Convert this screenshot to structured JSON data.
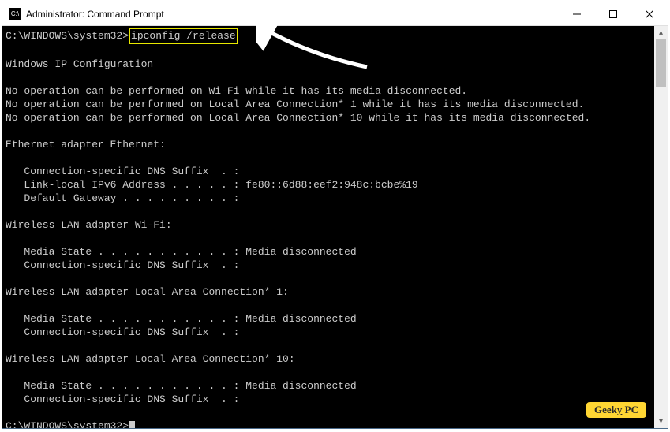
{
  "window": {
    "title": "Administrator: Command Prompt",
    "icon_label": "C:\\"
  },
  "terminal": {
    "prompt1_path": "C:\\WINDOWS\\system32>",
    "command_highlighted": "ipconfig /release",
    "blank1": "",
    "heading": "Windows IP Configuration",
    "blank2": "",
    "noop1": "No operation can be performed on Wi-Fi while it has its media disconnected.",
    "noop2": "No operation can be performed on Local Area Connection* 1 while it has its media disconnected.",
    "noop3": "No operation can be performed on Local Area Connection* 10 while it has its media disconnected.",
    "blank3": "",
    "adapter_eth_title": "Ethernet adapter Ethernet:",
    "blank4": "",
    "eth_suffix": "   Connection-specific DNS Suffix  . :",
    "eth_ipv6": "   Link-local IPv6 Address . . . . . : fe80::6d88:eef2:948c:bcbe%19",
    "eth_gw": "   Default Gateway . . . . . . . . . :",
    "blank5": "",
    "adapter_wifi_title": "Wireless LAN adapter Wi-Fi:",
    "blank6": "",
    "wifi_media": "   Media State . . . . . . . . . . . : Media disconnected",
    "wifi_suffix": "   Connection-specific DNS Suffix  . :",
    "blank7": "",
    "adapter_lac1_title": "Wireless LAN adapter Local Area Connection* 1:",
    "blank8": "",
    "lac1_media": "   Media State . . . . . . . . . . . : Media disconnected",
    "lac1_suffix": "   Connection-specific DNS Suffix  . :",
    "blank9": "",
    "adapter_lac10_title": "Wireless LAN adapter Local Area Connection* 10:",
    "blank10": "",
    "lac10_media": "   Media State . . . . . . . . . . . : Media disconnected",
    "lac10_suffix": "   Connection-specific DNS Suffix  . :",
    "blank11": "",
    "prompt2": "C:\\WINDOWS\\system32>"
  },
  "watermark": {
    "word1": "Geek",
    "word1_tail": "y",
    "word2": " PC"
  }
}
